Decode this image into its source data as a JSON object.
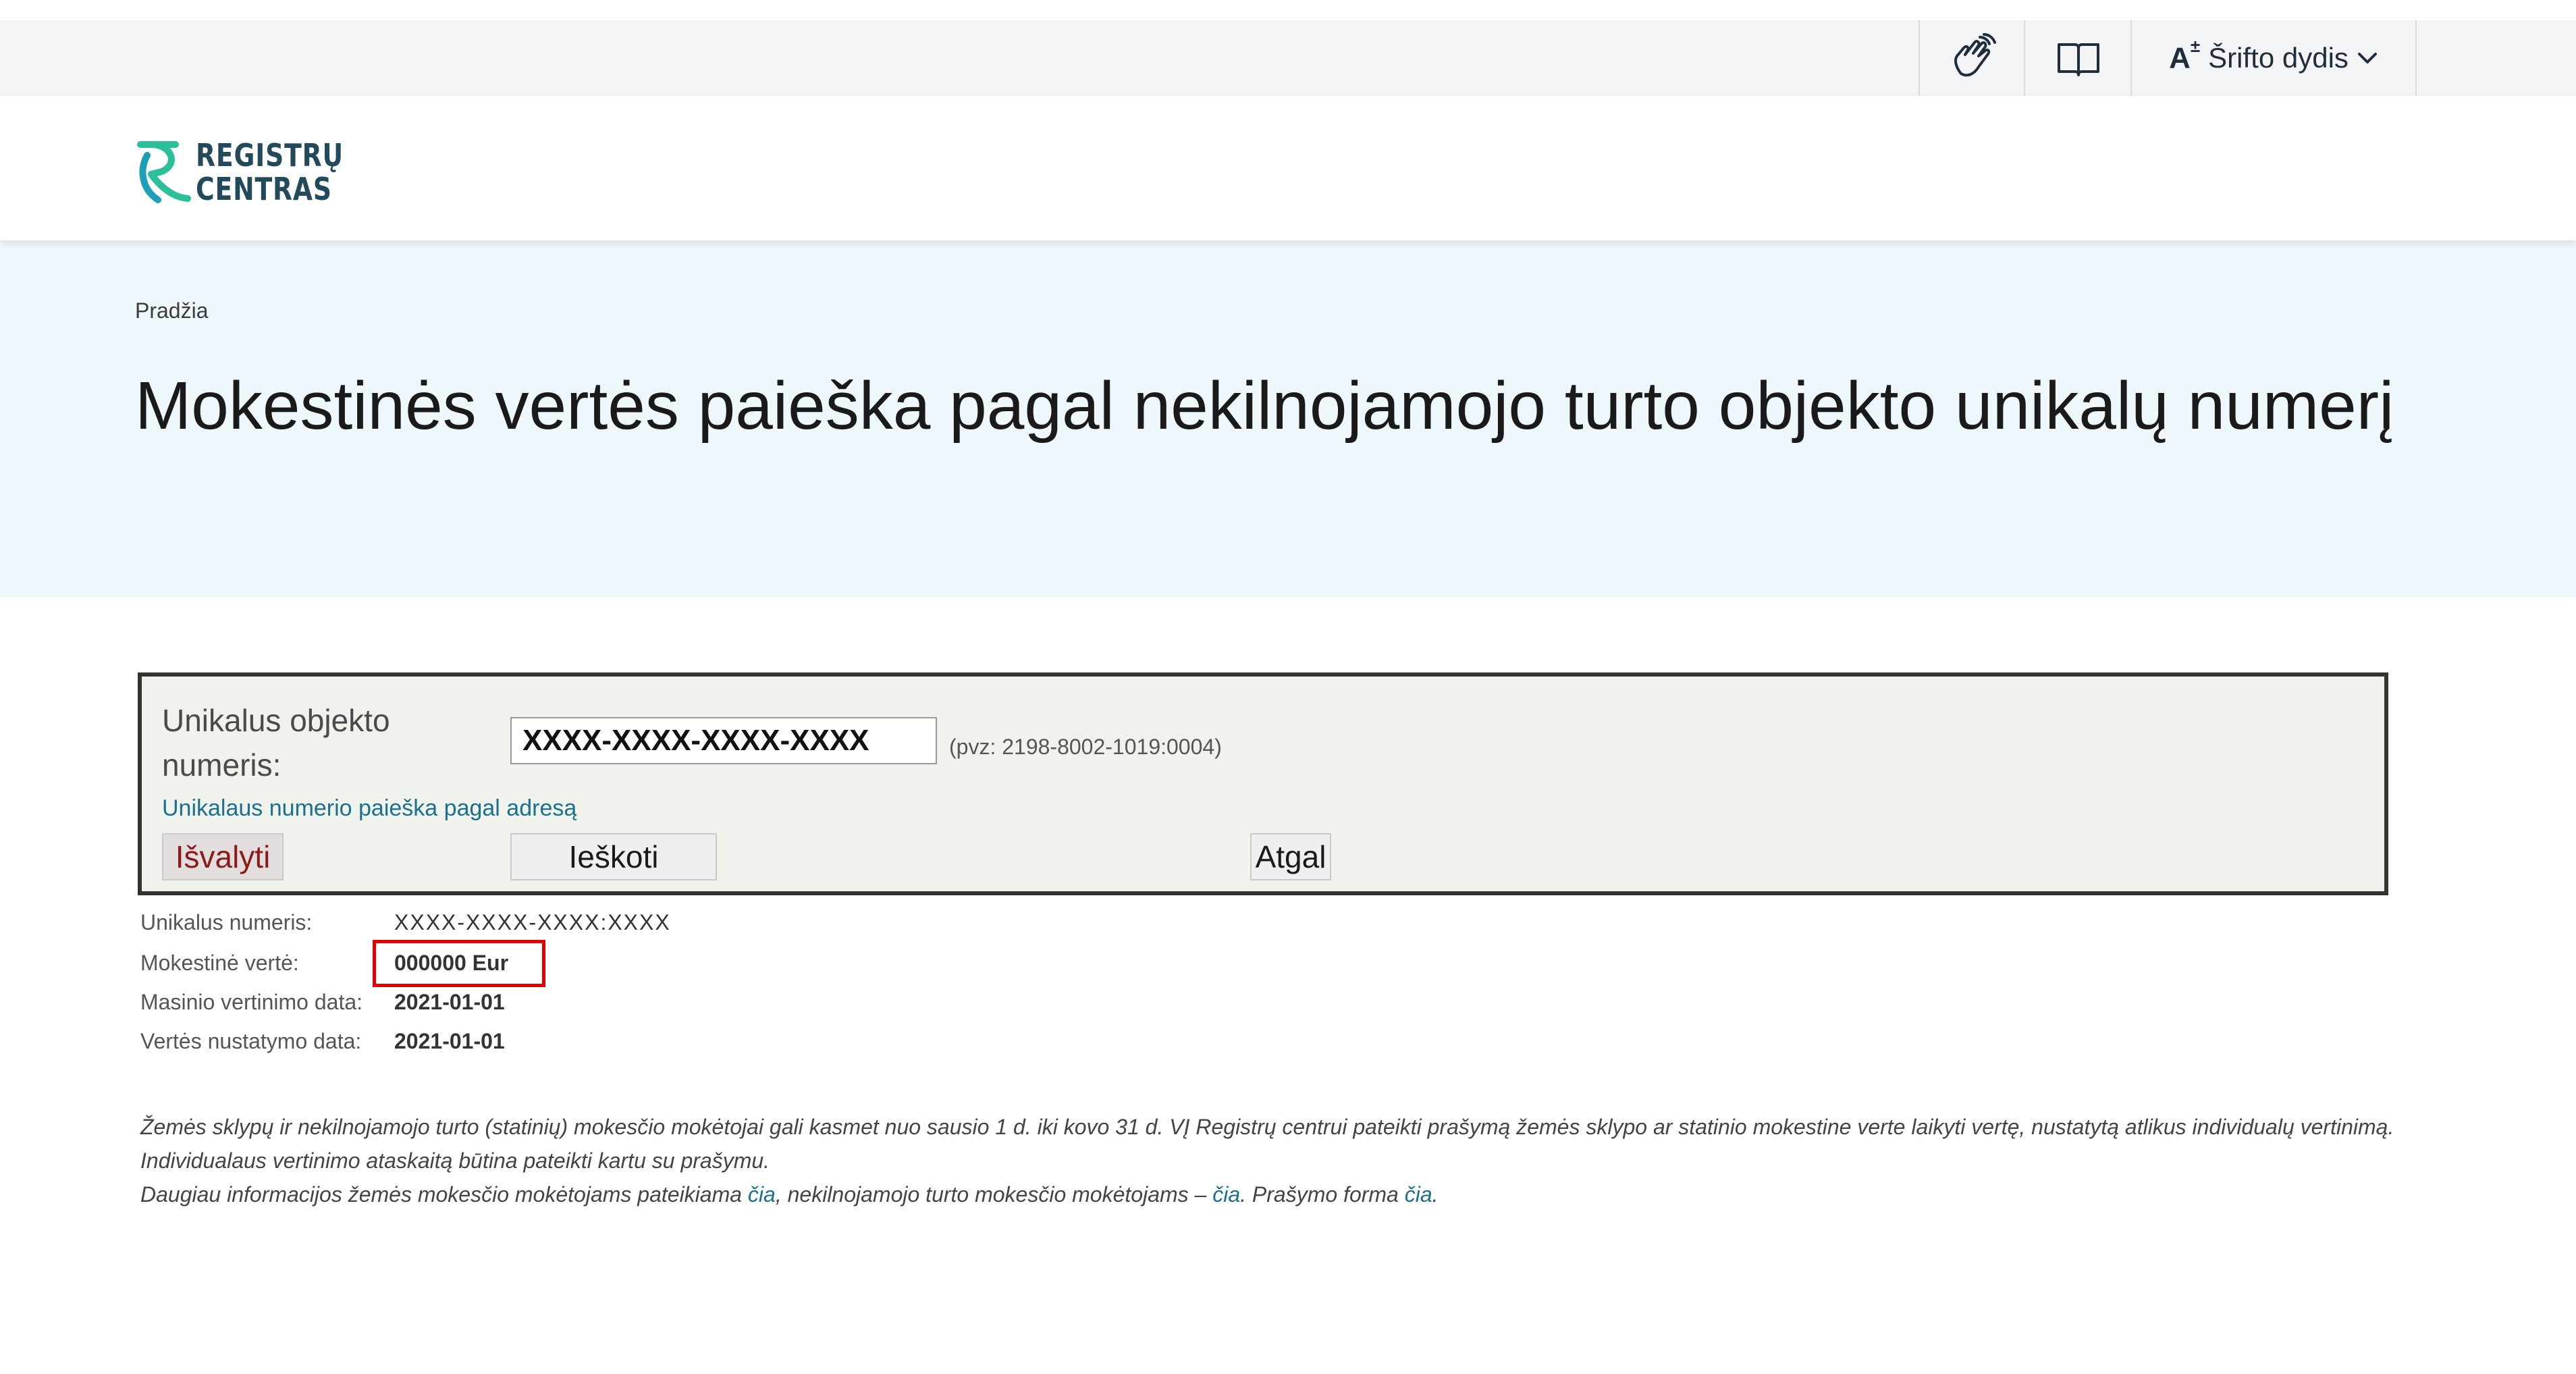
{
  "utility_bar": {
    "font_size_label": "Šrifto dydis"
  },
  "header": {
    "logo_line1": "REGISTRŲ",
    "logo_line2": "CENTRAS"
  },
  "hero": {
    "breadcrumb": "Pradžia",
    "title": "Mokestinės vertės paieška pagal nekilnojamojo turto objekto unikalų numerį"
  },
  "search_form": {
    "field_label": "Unikalus objekto numeris:",
    "field_value": "XXXX-XXXX-XXXX-XXXX",
    "example_hint": "(pvz: 2198-8002-1019:0004)",
    "address_search_link": "Unikalaus numerio paieška pagal adresą",
    "clear_button": "Išvalyti",
    "search_button": "Ieškoti",
    "back_button": "Atgal"
  },
  "results": {
    "unique_number_label": "Unikalus numeris:",
    "unique_number_value": "XXXX-XXXX-XXXX:XXXX",
    "tax_value_label": "Mokestinė vertė:",
    "tax_value_value": "000000 Eur",
    "mass_valuation_date_label": "Masinio vertinimo data:",
    "mass_valuation_date_value": "2021-01-01",
    "value_set_date_label": "Vertės nustatymo data:",
    "value_set_date_value": "2021-01-01"
  },
  "notes": {
    "paragraph1": "Žemės sklypų ir nekilnojamojo turto (statinių) mokesčio mokėtojai gali kasmet nuo sausio 1 d. iki kovo 31 d. VĮ Registrų centrui pateikti prašymą žemės sklypo ar statinio mokestine verte laikyti vertę, nustatytą atlikus individualų vertinimą. Individualaus vertinimo ataskaitą būtina pateikti kartu su prašymu.",
    "line2_part1": "Daugiau informacijos žemės mokesčio mokėtojams pateikiama ",
    "link1": "čia",
    "line2_part2": ", nekilnojamojo turto mokesčio mokėtojams – ",
    "link2": "čia",
    "line2_part3": ". Prašymo forma ",
    "link3": "čia",
    "line2_part4": "."
  },
  "colors": {
    "accent_link": "#1b6f8f",
    "hero_background": "#eef7fb",
    "panel_background": "#eff3ec",
    "highlight_border": "#e00000",
    "logo_green": "#2dbf9a"
  },
  "icons": [
    "sign-language-icon",
    "easy-read-book-icon",
    "font-size-icon",
    "chevron-down-icon",
    "registru-centras-logo-icon"
  ]
}
